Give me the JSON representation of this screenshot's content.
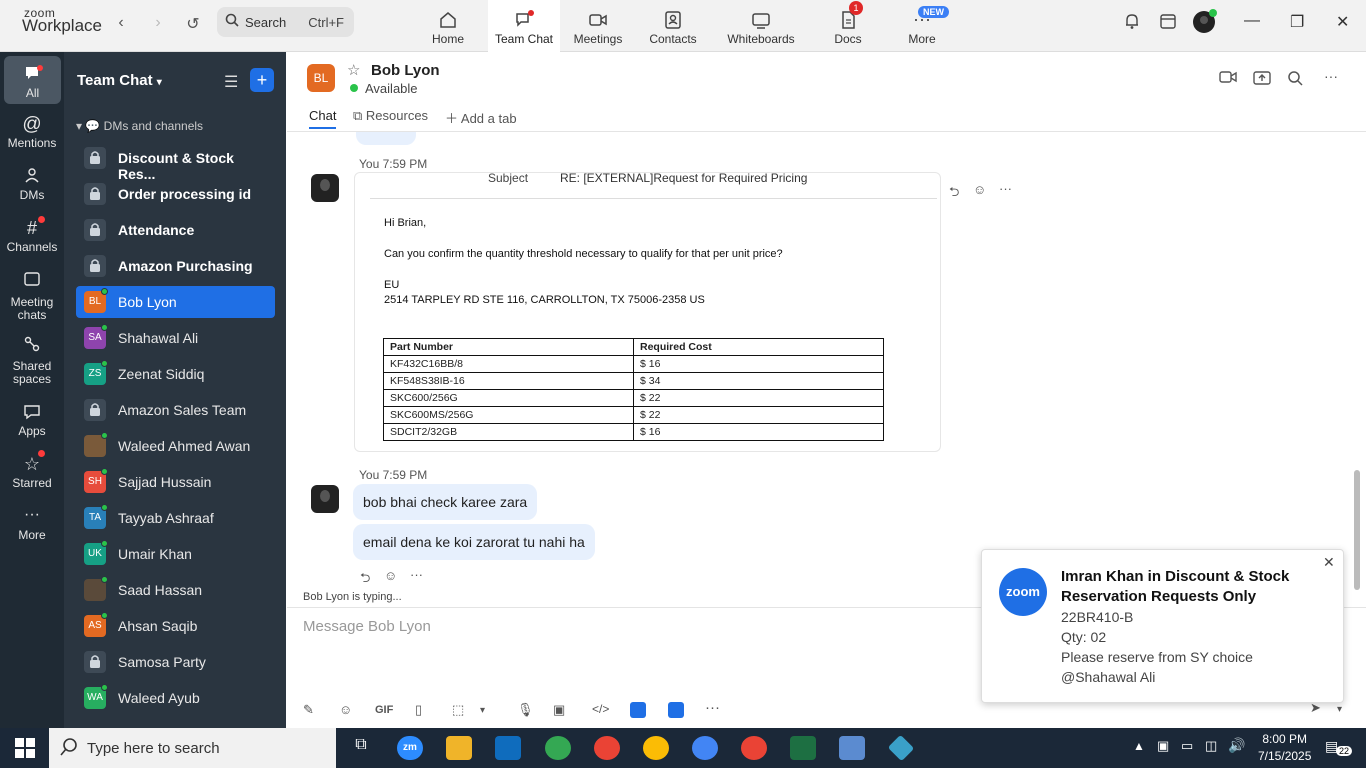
{
  "app": {
    "logo_top": "zoom",
    "logo_bottom": "Workplace"
  },
  "search": {
    "label": "Search",
    "shortcut": "Ctrl+F"
  },
  "top_tabs": [
    {
      "label": "Home",
      "icon": "home-icon"
    },
    {
      "label": "Team Chat",
      "icon": "chat-icon"
    },
    {
      "label": "Meetings",
      "icon": "video-icon"
    },
    {
      "label": "Contacts",
      "icon": "contacts-icon"
    },
    {
      "label": "Whiteboards",
      "icon": "whiteboard-icon"
    },
    {
      "label": "Docs",
      "icon": "docs-icon",
      "badge": "1"
    },
    {
      "label": "More",
      "icon": "more-icon",
      "badge": "NEW"
    }
  ],
  "rail": [
    {
      "label": "All"
    },
    {
      "label": "Mentions"
    },
    {
      "label": "DMs"
    },
    {
      "label": "Channels"
    },
    {
      "label": "Meeting chats"
    },
    {
      "label": "Shared spaces"
    },
    {
      "label": "Apps"
    },
    {
      "label": "Starred"
    },
    {
      "label": "More"
    }
  ],
  "sidebar": {
    "title": "Team Chat",
    "section": "DMs and channels",
    "items": [
      {
        "name": "Discount & Stock Res...",
        "type": "lock",
        "bold": true
      },
      {
        "name": "Order processing id",
        "type": "lock",
        "bold": true
      },
      {
        "name": "Attendance",
        "type": "lock",
        "bold": true
      },
      {
        "name": "Amazon Purchasing",
        "type": "lock",
        "bold": true
      },
      {
        "name": "Bob Lyon",
        "initials": "BL",
        "color": "#e36a22",
        "active": true
      },
      {
        "name": "Shahawal Ali",
        "initials": "SA",
        "color": "#8e44ad"
      },
      {
        "name": "Zeenat Siddiq",
        "initials": "ZS",
        "color": "#16a085"
      },
      {
        "name": "Amazon Sales Team",
        "type": "lock"
      },
      {
        "name": "Waleed Ahmed Awan",
        "initials": "",
        "color": "#7a5a3a"
      },
      {
        "name": "Sajjad Hussain",
        "initials": "SH",
        "color": "#e74c3c"
      },
      {
        "name": "Tayyab Ashraaf",
        "initials": "TA",
        "color": "#2980b9"
      },
      {
        "name": "Umair Khan",
        "initials": "UK",
        "color": "#16a085"
      },
      {
        "name": "Saad Hassan",
        "initials": "",
        "color": "#5a4a3a"
      },
      {
        "name": "Ahsan Saqib",
        "initials": "AS",
        "color": "#e36a22"
      },
      {
        "name": "Samosa Party",
        "type": "lock"
      },
      {
        "name": "Waleed Ayub",
        "initials": "WA",
        "color": "#27ae60"
      }
    ]
  },
  "chat_header": {
    "initials": "BL",
    "name": "Bob Lyon",
    "status": "Available",
    "tabs": [
      "Chat",
      "Resources",
      "Add a tab"
    ]
  },
  "messages": {
    "first_meta": "You 7:59 PM",
    "email": {
      "subject_label": "Subject",
      "subject": "RE: [EXTERNAL]Request for Required Pricing",
      "greeting": "Hi Brian,",
      "body": "Can you confirm the quantity threshold necessary to qualify for that per unit price?",
      "addr1": "EU",
      "addr2": "2514 TARPLEY RD STE 116, CARROLLTON, TX 75006-2358 US",
      "table_headers": [
        "Part Number",
        "Required Cost"
      ],
      "rows": [
        [
          "KF432C16BB/8",
          "$ 16"
        ],
        [
          "KF548S38IB-16",
          "$ 34"
        ],
        [
          "SKC600/256G",
          "$ 22"
        ],
        [
          "SKC600MS/256G",
          "$ 22"
        ],
        [
          "SDCIT2/32GB",
          "$ 16"
        ]
      ]
    },
    "second_meta": "You 7:59 PM",
    "bubble1": "bob bhai check karee zara",
    "bubble2": "email dena ke koi zarorat tu nahi ha",
    "typing": "Bob Lyon  is typing..."
  },
  "composer": {
    "placeholder": "Message Bob Lyon",
    "gif_label": "GIF"
  },
  "notification": {
    "logo": "zoom",
    "title": "Imran Khan in Discount & Stock Reservation Requests Only",
    "line1": "22BR410-B",
    "line2": "Qty: 02",
    "line3": "Please reserve from SY choice",
    "line4": "@Shahawal Ali"
  },
  "taskbar": {
    "search": "Type here to search",
    "time": "8:00 PM",
    "date": "7/15/2025",
    "notif_count": "22"
  }
}
